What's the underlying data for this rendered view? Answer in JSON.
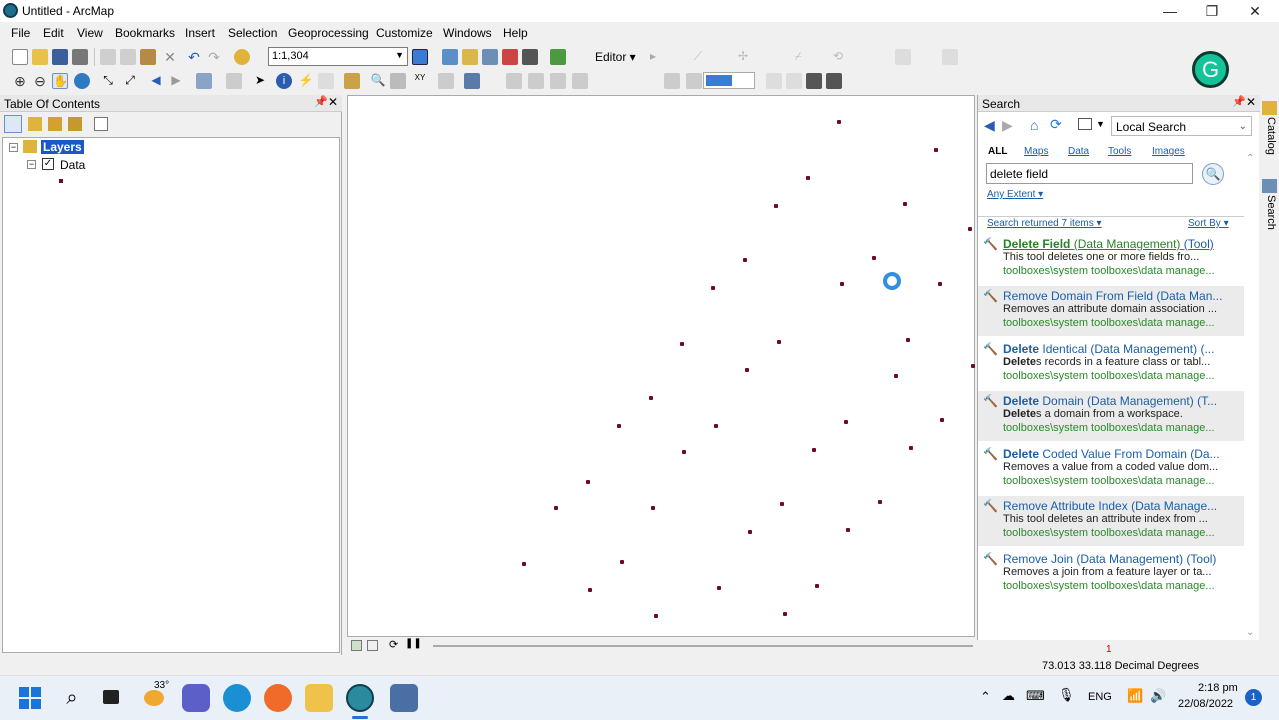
{
  "window": {
    "title": "Untitled - ArcMap",
    "minimize": "—",
    "restore": "❐",
    "close": "✕"
  },
  "menu": [
    "File",
    "Edit",
    "View",
    "Bookmarks",
    "Insert",
    "Selection",
    "Geoprocessing",
    "Customize",
    "Windows",
    "Help"
  ],
  "toolbar": {
    "scale": "1:1,304",
    "editor_label": "Editor ▾"
  },
  "toc": {
    "title": "Table Of Contents",
    "layers_label": "Layers",
    "data_label": "Data"
  },
  "search": {
    "title": "Search",
    "scope": "Local Search",
    "tabs": [
      "ALL",
      "Maps",
      "Data",
      "Tools",
      "Images"
    ],
    "query": "delete field",
    "extent": "Any Extent ▾",
    "returned": "Search returned 7 items ▾",
    "sort": "Sort By ▾",
    "results": [
      {
        "title_bold": "Delete Field",
        "title_rest": " (Data Management)",
        "title_tag": " (Tool)",
        "desc_bold": "",
        "desc": "This tool deletes one or more fields fro...",
        "path": "toolboxes\\system toolboxes\\data manage..."
      },
      {
        "title_bold": "",
        "title_rest": "Remove Domain From Field (Data Man...",
        "title_tag": "",
        "desc_bold": "",
        "desc": "Removes an attribute domain association ...",
        "path": "toolboxes\\system toolboxes\\data manage..."
      },
      {
        "title_bold": "Delete",
        "title_rest": " Identical (Data Management) (...",
        "title_tag": "",
        "desc_bold": "Delete",
        "desc": "s records in a feature class or tabl...",
        "path": "toolboxes\\system toolboxes\\data manage..."
      },
      {
        "title_bold": "Delete",
        "title_rest": " Domain (Data Management) (T...",
        "title_tag": "",
        "desc_bold": "Delete",
        "desc": "s a domain from a workspace.",
        "path": "toolboxes\\system toolboxes\\data manage..."
      },
      {
        "title_bold": "Delete",
        "title_rest": " Coded Value From Domain (Da...",
        "title_tag": "",
        "desc_bold": "",
        "desc": "Removes a value from a coded value dom...",
        "path": "toolboxes\\system toolboxes\\data manage..."
      },
      {
        "title_bold": "",
        "title_rest": "Remove Attribute Index (Data Manage...",
        "title_tag": "",
        "desc_bold": "",
        "desc": "This tool deletes an attribute index from ...",
        "path": "toolboxes\\system toolboxes\\data manage..."
      },
      {
        "title_bold": "",
        "title_rest": "Remove Join (Data Management) (Tool)",
        "title_tag": "",
        "desc_bold": "",
        "desc": "Removes a join from a feature layer or ta...",
        "path": "toolboxes\\system toolboxes\\data manage..."
      }
    ]
  },
  "side_tabs": [
    "Catalog",
    "Search"
  ],
  "status": {
    "count": "1",
    "coords": "73.013  33.118 Decimal Degrees"
  },
  "taskbar": {
    "weather": "33°",
    "lang": "ENG",
    "time": "2:18 pm",
    "date": "22/08/2022",
    "badge": "1"
  },
  "grammarly_letter": "G"
}
